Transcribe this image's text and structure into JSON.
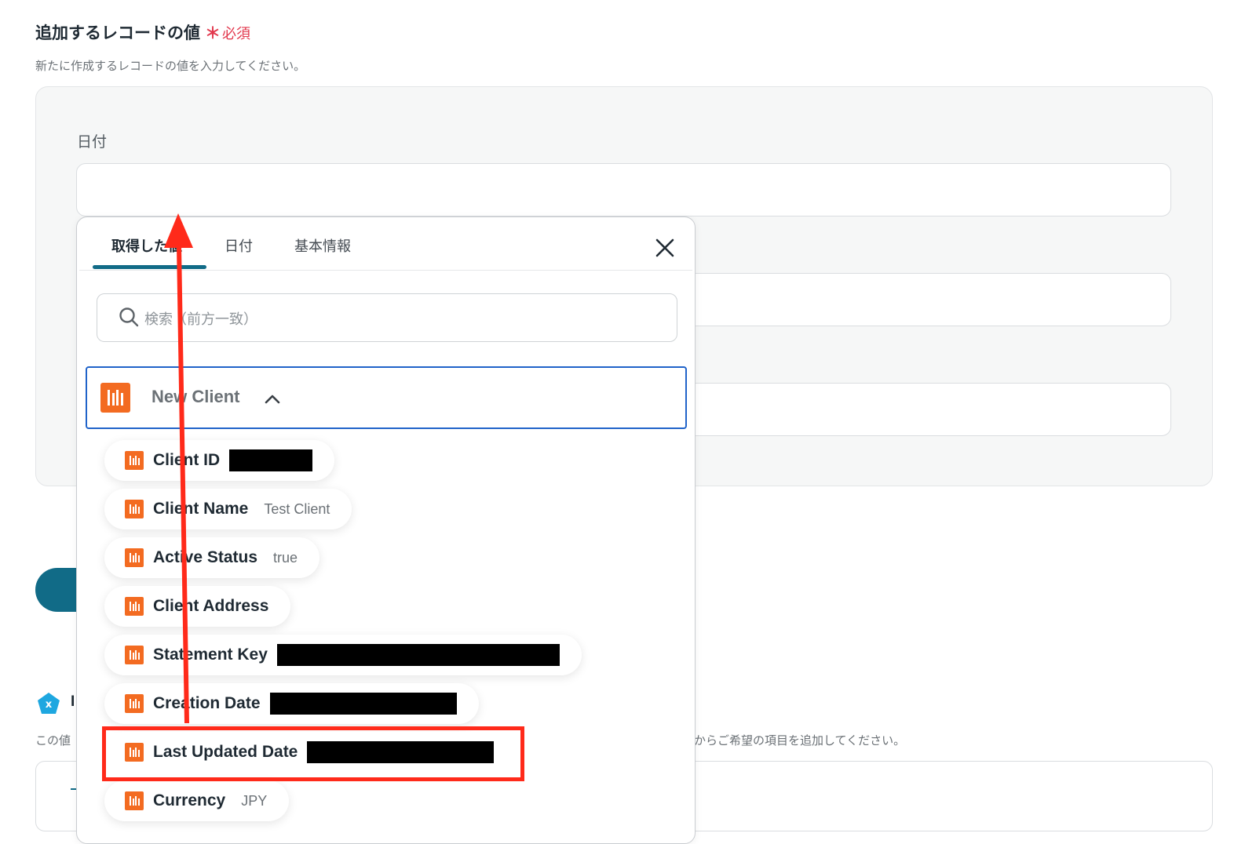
{
  "section": {
    "title": "追加するレコードの値",
    "required_mark": "＊",
    "required_label": "必須",
    "description": "新たに作成するレコードの値を入力してください。"
  },
  "field": {
    "label": "日付"
  },
  "popup": {
    "tabs": [
      {
        "label": "取得した値",
        "active": true
      },
      {
        "label": "日付",
        "active": false
      },
      {
        "label": "基本情報",
        "active": false
      }
    ],
    "search_placeholder": "検索（前方一致）",
    "group": {
      "name": "New Client",
      "brand_color": "#f36b21"
    },
    "items": [
      {
        "name": "Client ID",
        "value": "",
        "redacted": true
      },
      {
        "name": "Client Name",
        "value": "Test Client",
        "redacted": false
      },
      {
        "name": "Active Status",
        "value": "true",
        "redacted": false
      },
      {
        "name": "Client Address",
        "value": "",
        "redacted": false
      },
      {
        "name": "Statement Key",
        "value": "",
        "redacted": true
      },
      {
        "name": "Creation Date",
        "value": "",
        "redacted": true
      },
      {
        "name": "Last Updated Date",
        "value": "",
        "redacted": true,
        "highlighted": true
      },
      {
        "name": "Currency",
        "value": "JPY",
        "redacted": false
      }
    ]
  },
  "bottom": {
    "label": "I",
    "desc_left": "この値",
    "desc_right": "からご希望の項目を追加してください。"
  },
  "colors": {
    "accent": "#116b87",
    "selection": "#2063c9",
    "annotation": "#ff2a1a",
    "required": "#e2384d"
  }
}
